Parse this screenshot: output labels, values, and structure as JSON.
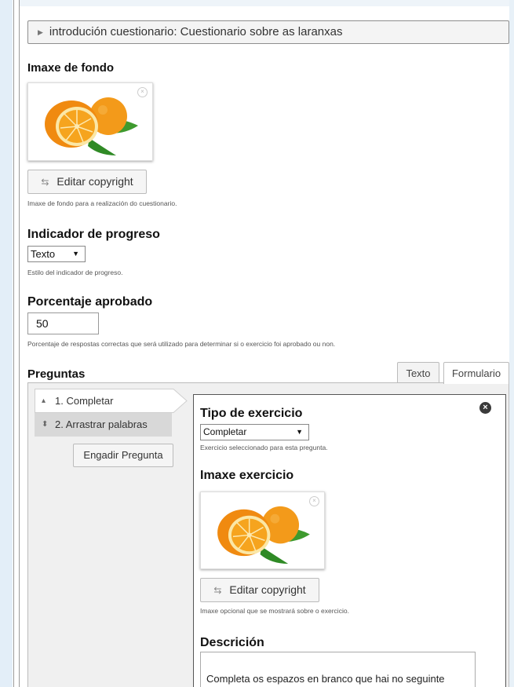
{
  "intro": {
    "label": "introdución cuestionario: Cuestionario sobre as laranxas"
  },
  "background_image": {
    "label": "Imaxe de fondo",
    "copyright_button": "Editar copyright",
    "description": "Imaxe de fondo para a realización do cuestionario."
  },
  "progress_indicator": {
    "label": "Indicador de progreso",
    "selected": "Texto",
    "description": "Estilo del indicador de progreso."
  },
  "pass_percentage": {
    "label": "Porcentaje aprobado",
    "value": "50",
    "description": "Porcentaje de respostas correctas que será utilizado para determinar si o exercicio foi aprobado ou non."
  },
  "questions": {
    "label": "Preguntas",
    "tabs": [
      "Texto",
      "Formulario"
    ],
    "items": [
      "1. Completar",
      "2. Arrastrar palabras"
    ],
    "add_button": "Engadir Pregunta"
  },
  "form": {
    "exercise_type": {
      "label": "Tipo de exercicio",
      "selected": "Completar",
      "description": "Exercicio seleccionado para esta pregunta."
    },
    "exercise_image": {
      "label": "Imaxe exercicio",
      "copyright_button": "Editar copyright",
      "description": "Imaxe opcional que se mostrará sobre o exercicio."
    },
    "description": {
      "label": "Descrición",
      "text": "Completa os espazos en branco que hai no seguinte"
    }
  },
  "colors": {
    "orange": "#f39a1a",
    "leaf": "#3e9a2e",
    "panel_bg": "#f0f0f0"
  }
}
